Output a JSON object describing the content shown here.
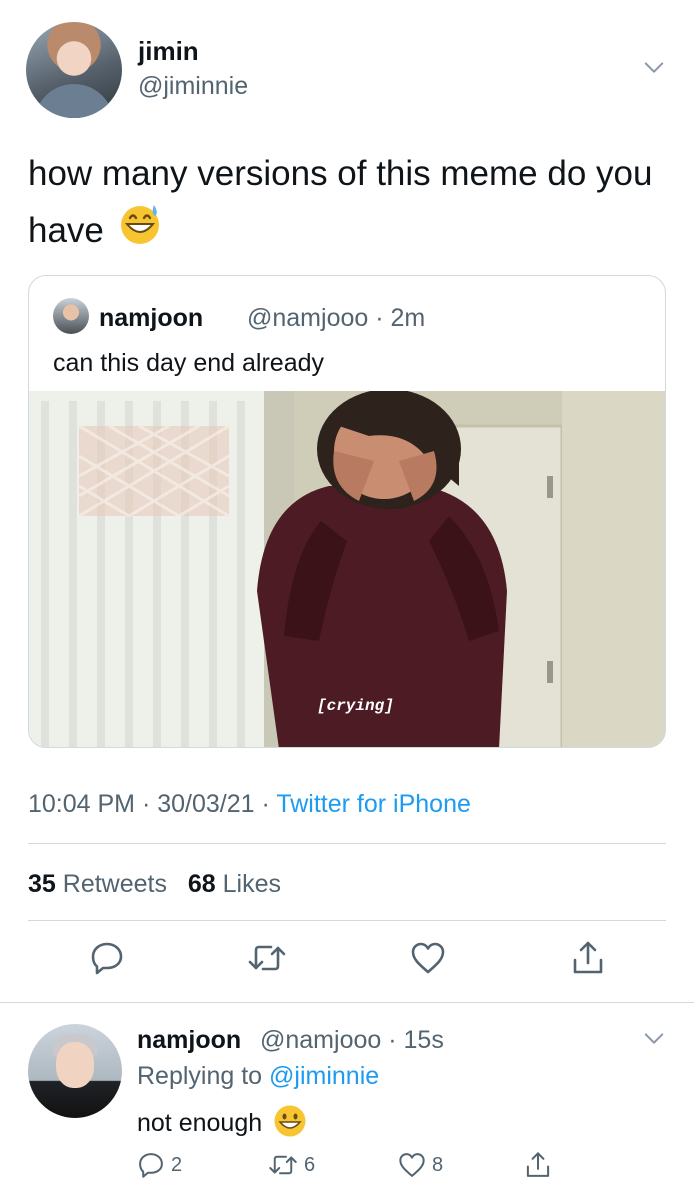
{
  "tweet": {
    "author_name": "jimin",
    "author_handle": "@jiminnie",
    "text": "how many versions of this meme do you have",
    "text_emoji": "sweat-smile-emoji",
    "quoted": {
      "author_name": "namjoon",
      "author_handle": "@namjooo",
      "separator": "·",
      "time": "2m",
      "text": "can this day end already",
      "media_caption": "[crying]"
    },
    "time": "10:04 PM",
    "date": "30/03/21",
    "separator": "·",
    "source": "Twitter for iPhone",
    "retweets_count": "35",
    "retweets_label": "Retweets",
    "likes_count": "68",
    "likes_label": "Likes"
  },
  "reply": {
    "author_name": "namjoon",
    "author_handle": "@namjooo",
    "separator": "·",
    "time": "15s",
    "replying_to_label": "Replying to",
    "replying_to_handle": "@jiminnie",
    "text": "not enough",
    "text_emoji": "grinning-face-emoji",
    "reply_count": "2",
    "retweet_count": "6",
    "like_count": "8"
  },
  "icons": {
    "reply": "speech-bubble-icon",
    "retweet": "retweet-icon",
    "like": "heart-icon",
    "share": "share-icon",
    "more": "chevron-down-icon"
  },
  "colors": {
    "accent": "#1d9bf0",
    "text": "#0f1419",
    "muted": "#536471",
    "divider": "#cfd9de"
  }
}
